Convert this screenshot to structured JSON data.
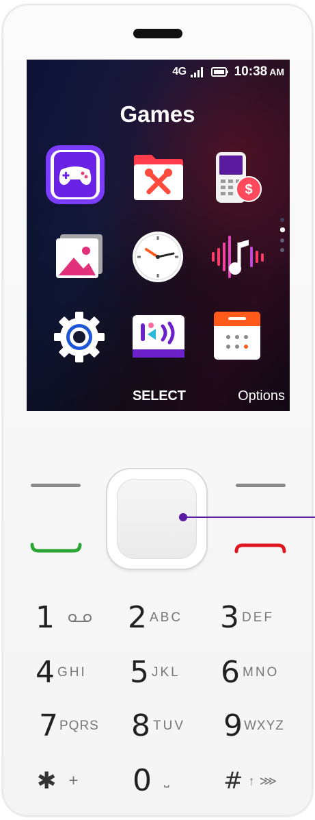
{
  "status": {
    "network": "4G",
    "time": "10:38",
    "ampm": "AM"
  },
  "screen": {
    "title": "Games"
  },
  "apps": [
    {
      "name": "games-icon"
    },
    {
      "name": "tools-icon"
    },
    {
      "name": "phone-wallet-icon"
    },
    {
      "name": "gallery-icon"
    },
    {
      "name": "clock-icon"
    },
    {
      "name": "music-icon"
    },
    {
      "name": "settings-icon"
    },
    {
      "name": "kai-store-icon"
    },
    {
      "name": "calendar-icon"
    }
  ],
  "softkeys": {
    "center": "SELECT",
    "right": "Options"
  },
  "keypad": [
    {
      "num": "1",
      "letters": ""
    },
    {
      "num": "2",
      "letters": "ABC"
    },
    {
      "num": "3",
      "letters": "DEF"
    },
    {
      "num": "4",
      "letters": "GHI"
    },
    {
      "num": "5",
      "letters": "JKL"
    },
    {
      "num": "6",
      "letters": "MNO"
    },
    {
      "num": "7",
      "letters": "PQRS"
    },
    {
      "num": "8",
      "letters": "TUV"
    },
    {
      "num": "9",
      "letters": "WXYZ"
    },
    {
      "num": "✱",
      "letters": "+"
    },
    {
      "num": "0",
      "letters": "⎵"
    },
    {
      "num": "#",
      "letters": "↑ ⋙"
    }
  ],
  "colors": {
    "call": "#2aa533",
    "end": "#e0161f",
    "accent": "#5a1aa0"
  }
}
